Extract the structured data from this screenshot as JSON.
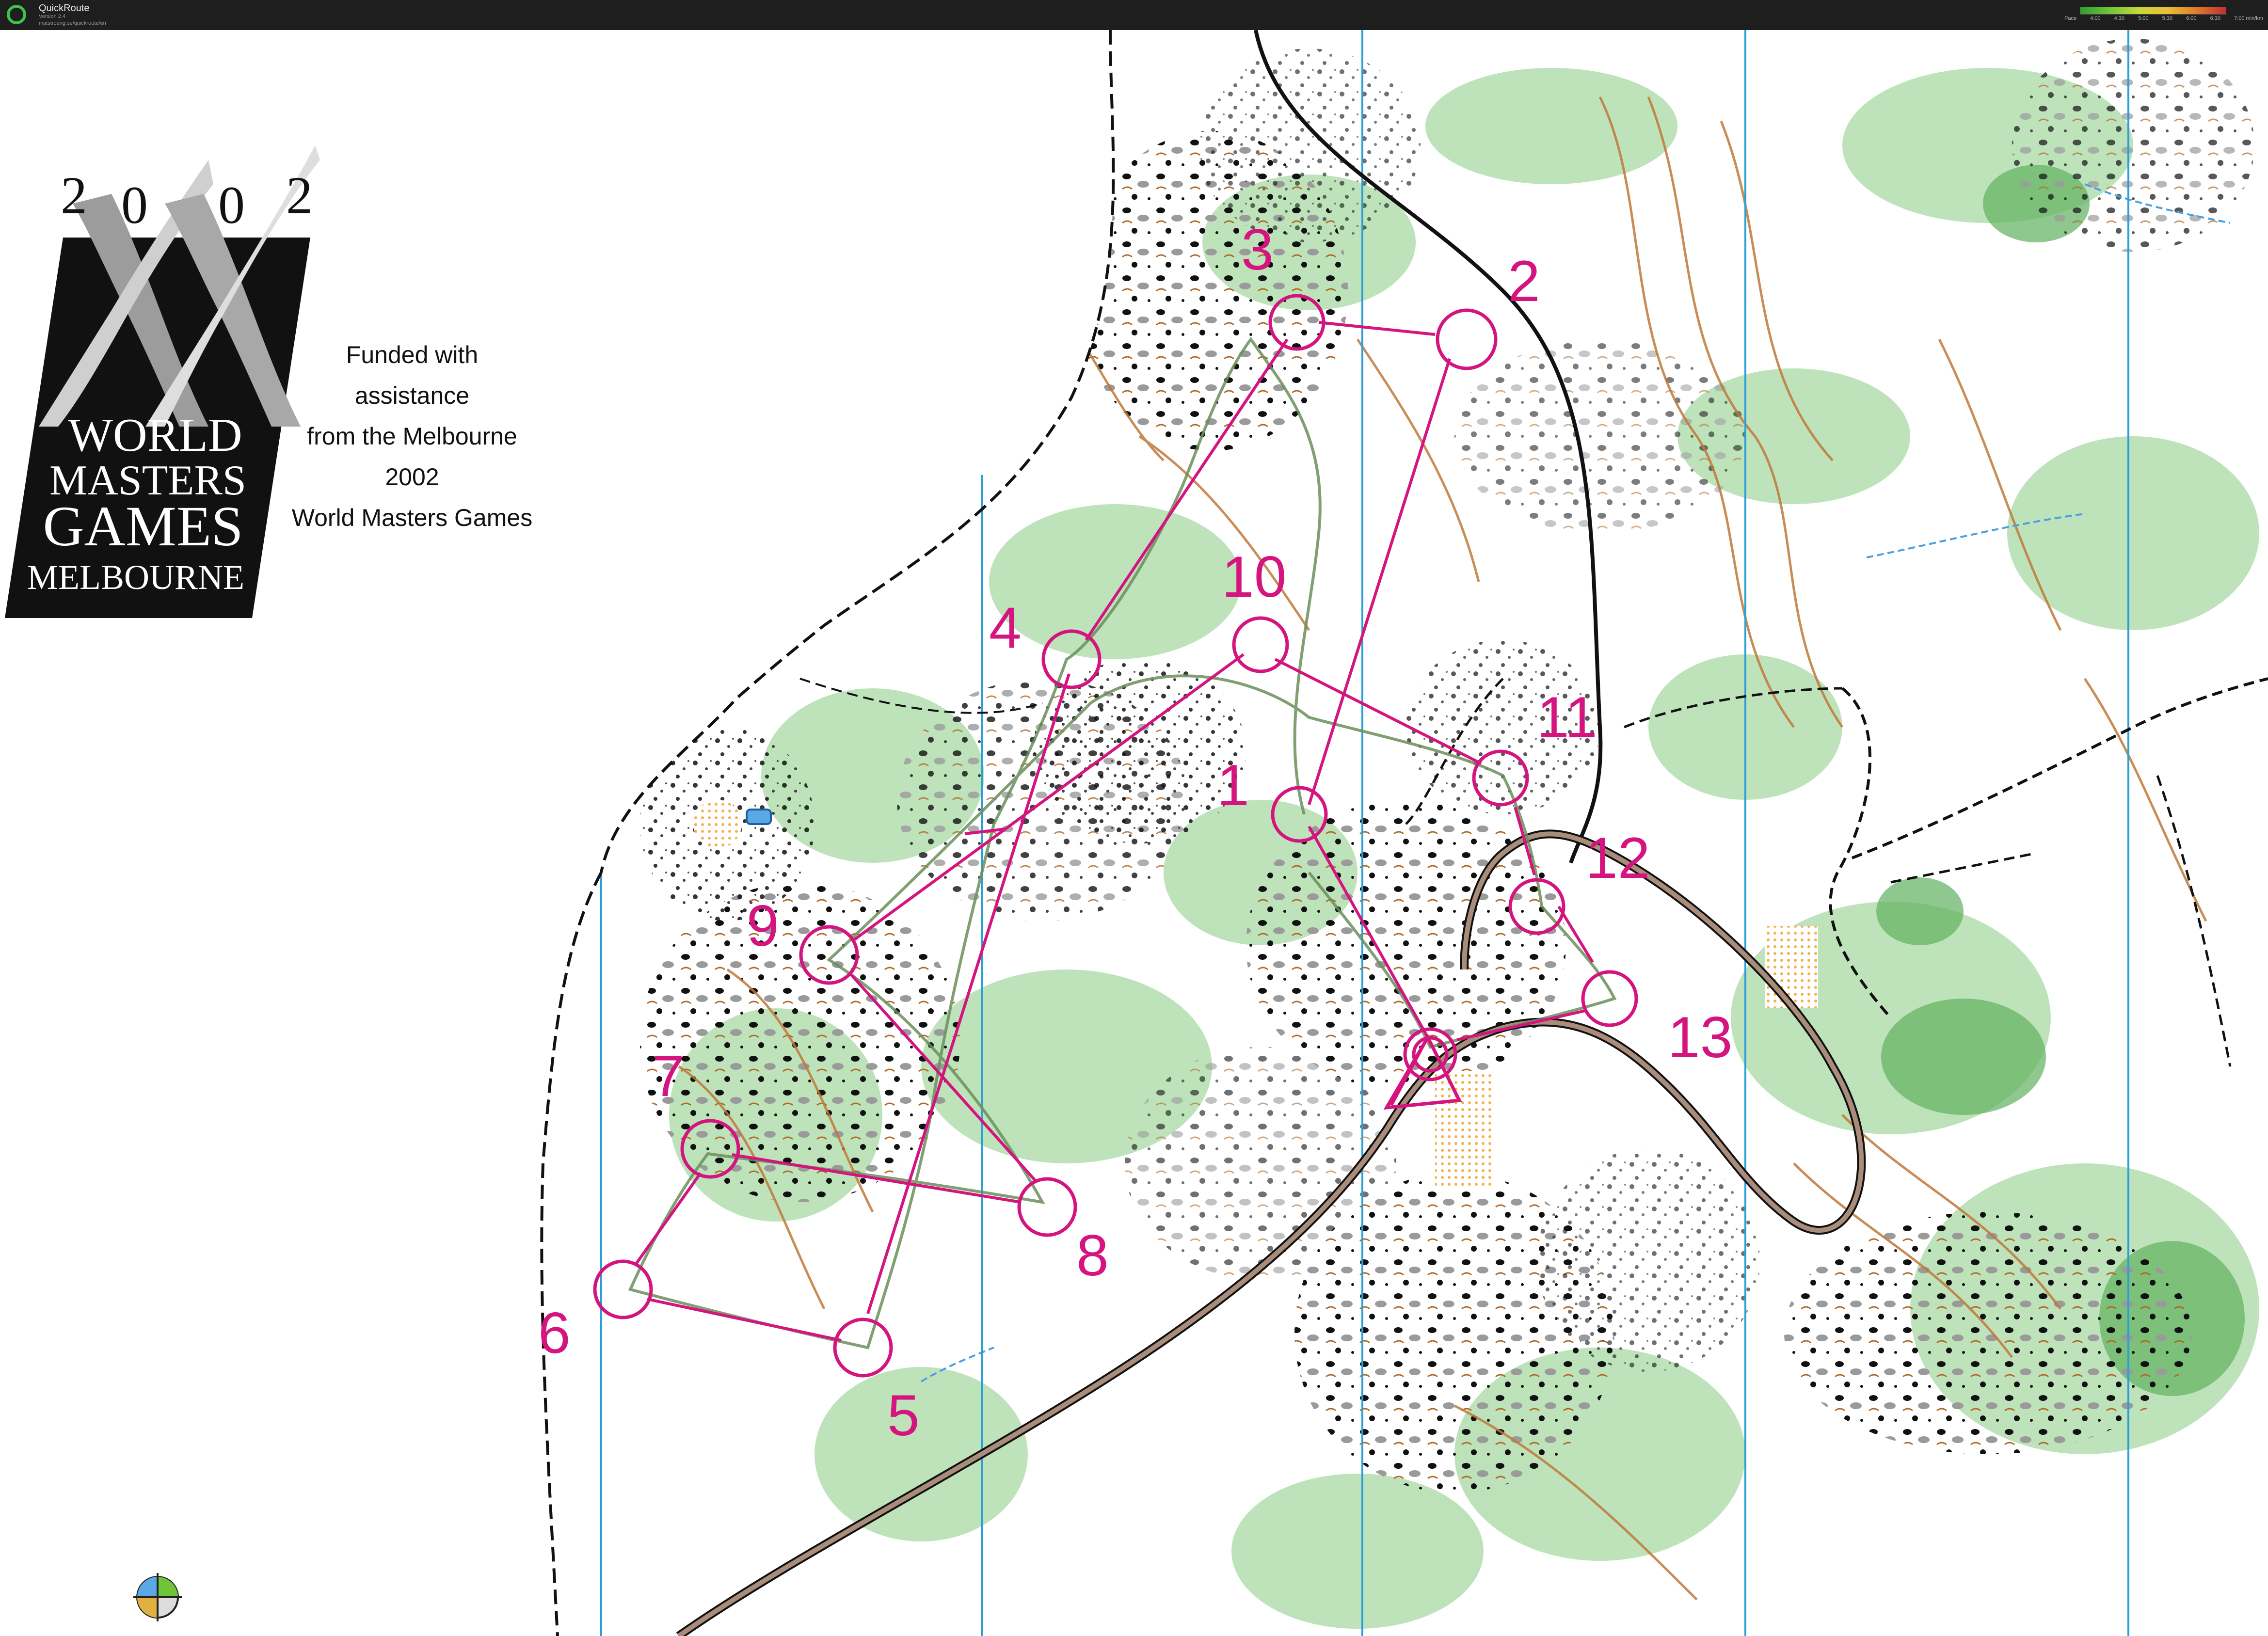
{
  "app": {
    "title": "QuickRoute",
    "version": "Version 2.4",
    "url": "matstroeng.se/quickroute/en"
  },
  "legend": {
    "label": "Pace",
    "ticks": [
      "4:00",
      "4:30",
      "5:00",
      "5:30",
      "6:00",
      "6:30",
      "7:00 min/km"
    ]
  },
  "logo": {
    "year_digits": [
      "2",
      "0",
      "0",
      "2"
    ],
    "lines": [
      "WORLD",
      "MASTERS",
      "GAMES",
      "MELBOURNE"
    ]
  },
  "funding_note": [
    "Funded with assistance",
    "from the Melbourne 2002",
    "World Masters Games"
  ],
  "colors": {
    "course": "#d4147f",
    "route": "#6a8f5a",
    "contour": "#c0793a",
    "vegetation": "#9ed49a",
    "meridian": "#2a9fd8",
    "road": "#111111"
  },
  "course_controls": [
    "1",
    "2",
    "3",
    "4",
    "5",
    "6",
    "7",
    "8",
    "9",
    "10",
    "11",
    "12",
    "13"
  ]
}
